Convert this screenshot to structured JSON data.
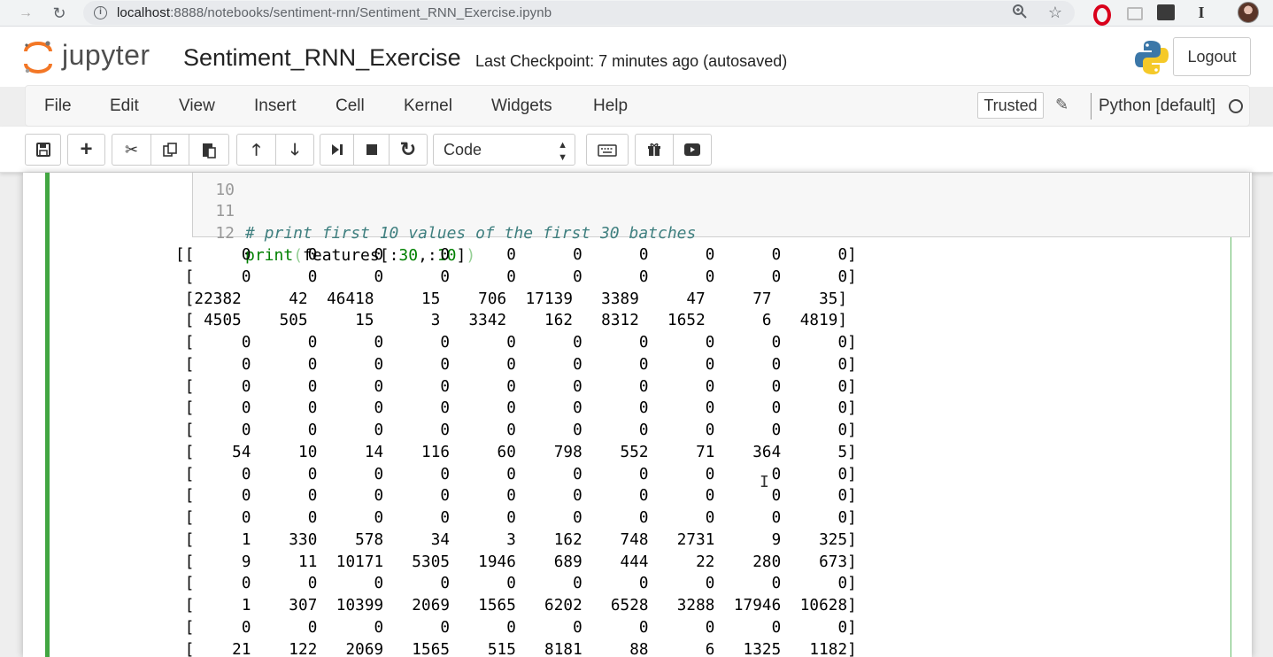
{
  "browser": {
    "url_host": "localhost",
    "url_rest": ":8888/notebooks/sentiment-rnn/Sentiment_RNN_Exercise.ipynb",
    "back_icon": "arrow-left-icon",
    "reload_icon": "reload-icon",
    "info_icon": "info-icon",
    "zoom_icon": "zoom-icon",
    "bookmark_icon": "star-icon",
    "extension_icons": [
      "opera-icon",
      "extension-icon",
      "extension-icon",
      "serif-i-icon"
    ]
  },
  "header": {
    "logo_text": "jupyter",
    "notebook_name": "Sentiment_RNN_Exercise",
    "checkpoint": "Last Checkpoint: 7 minutes ago (autosaved)",
    "logout_label": "Logout"
  },
  "menubar": {
    "items": [
      "File",
      "Edit",
      "View",
      "Insert",
      "Cell",
      "Kernel",
      "Widgets",
      "Help"
    ],
    "trusted_label": "Trusted",
    "kernel_name": "Python [default]"
  },
  "toolbar": {
    "buttons": [
      "save-icon",
      "plus-icon",
      "scissors-icon",
      "copy-icon",
      "paste-icon",
      "arrow-up-icon",
      "arrow-down-icon",
      "run-step-icon",
      "stop-icon",
      "restart-icon"
    ],
    "cell_type": "Code",
    "extra_buttons": [
      "keyboard-icon",
      "gift-icon",
      "play-icon"
    ]
  },
  "code": {
    "lines": [
      {
        "no": "10",
        "text": ""
      },
      {
        "no": "11",
        "text": "# print first 10 values of the first 30 batches"
      },
      {
        "no": "12",
        "text": "print(features[:30,:10])"
      }
    ]
  },
  "output": {
    "rows": [
      "[[     0      0      0      0      0      0      0      0      0      0]",
      " [     0      0      0      0      0      0      0      0      0      0]",
      " [22382     42  46418     15    706  17139   3389     47     77     35]",
      " [ 4505    505     15      3   3342    162   8312   1652      6   4819]",
      " [     0      0      0      0      0      0      0      0      0      0]",
      " [     0      0      0      0      0      0      0      0      0      0]",
      " [     0      0      0      0      0      0      0      0      0      0]",
      " [     0      0      0      0      0      0      0      0      0      0]",
      " [     0      0      0      0      0      0      0      0      0      0]",
      " [    54     10     14    116     60    798    552     71    364      5]",
      " [     0      0      0      0      0      0      0      0      0      0]",
      " [     0      0      0      0      0      0      0      0      0      0]",
      " [     0      0      0      0      0      0      0      0      0      0]",
      " [     1    330    578     34      3    162    748   2731      9    325]",
      " [     9     11  10171   5305   1946    689    444     22    280    673]",
      " [     0      0      0      0      0      0      0      0      0      0]",
      " [     1    307  10399   2069   1565   6202   6528   3288  17946  10628]",
      " [     0      0      0      0      0      0      0      0      0      0]",
      " [    21    122   2069   1565    515   8181     88      6   1325   1182]"
    ]
  },
  "colors": {
    "cell_border": "#42a642",
    "comment": "#408080",
    "builtin": "#008000",
    "jupyter_orange": "#f37726"
  }
}
